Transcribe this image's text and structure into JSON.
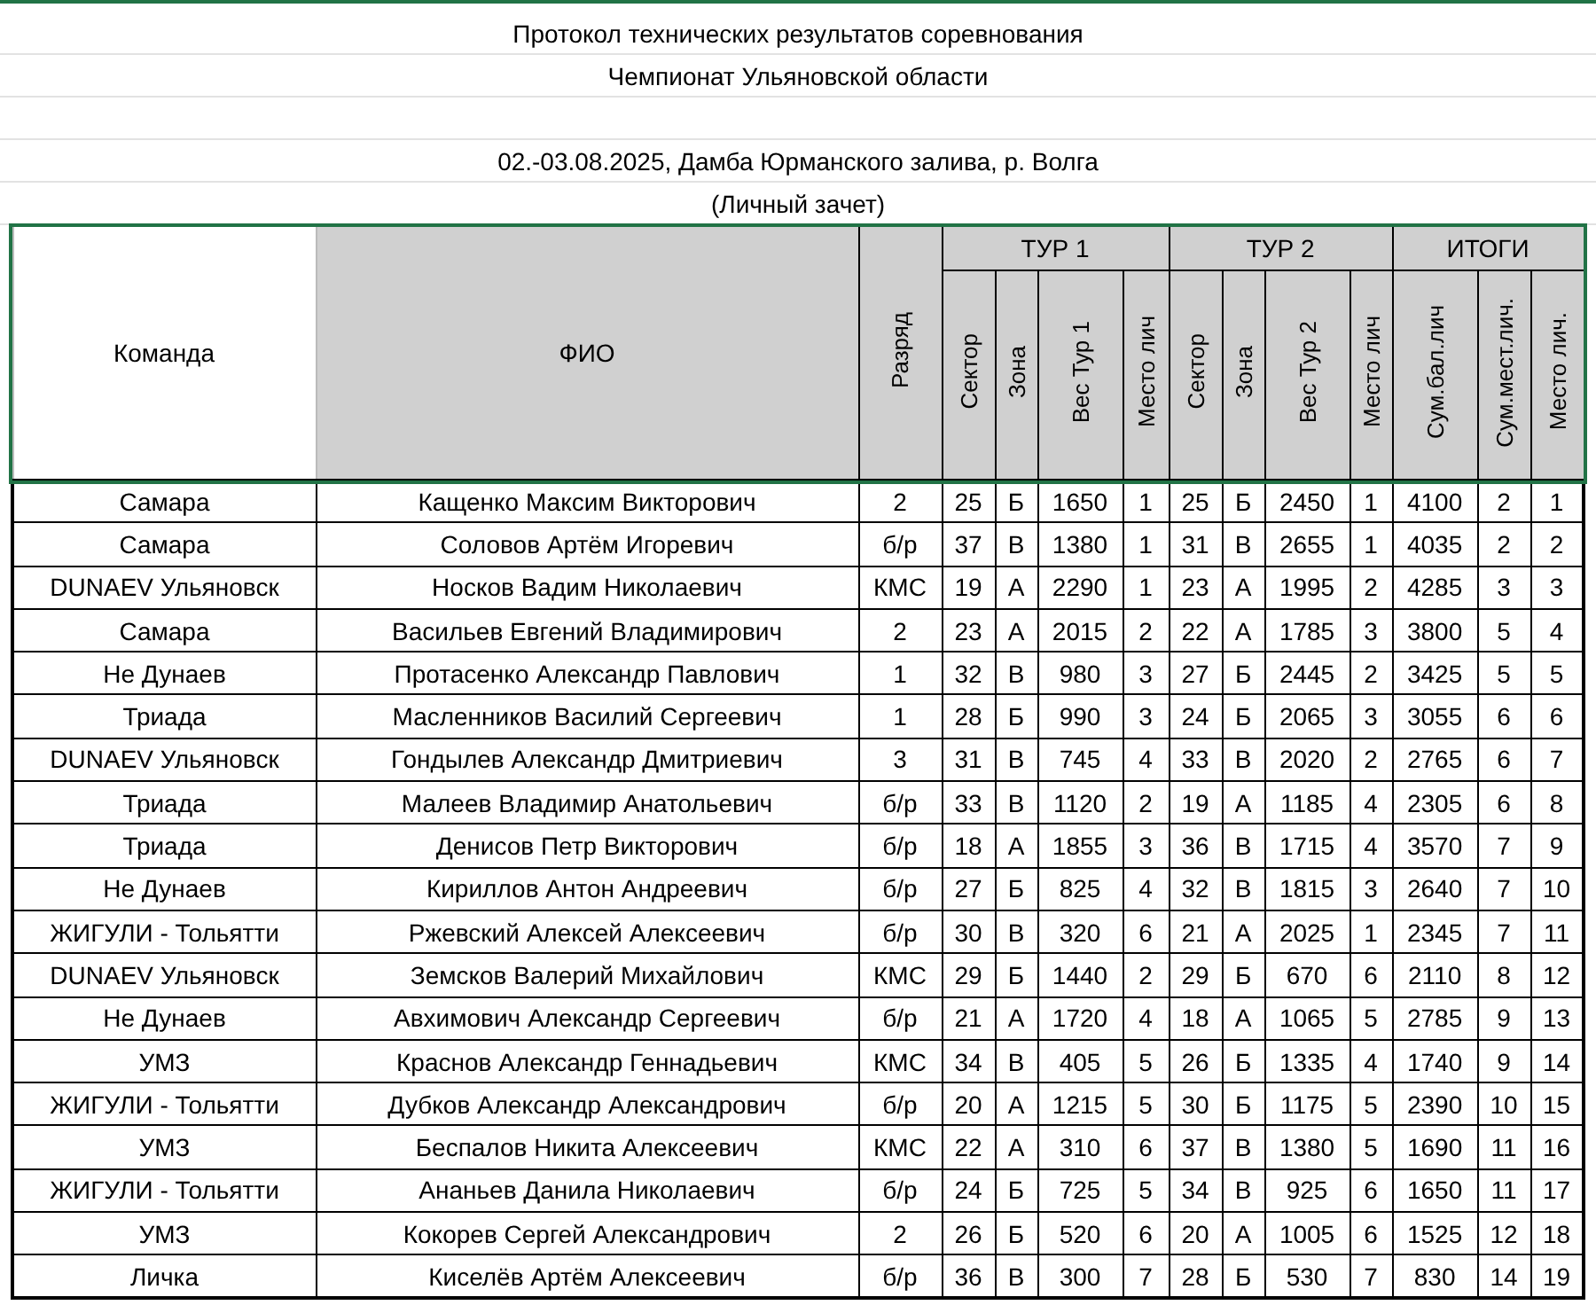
{
  "heading": [
    "Протокол технических результатов соревнования",
    "Чемпионат Ульяновской области"
  ],
  "details": [
    "02.-03.08.2025, Дамба Юрманского залива, р. Волга",
    "(Личный зачет)"
  ],
  "table": {
    "columns": [
      {
        "label": "Команда",
        "vertical": false,
        "shaded": false
      },
      {
        "label": "ФИО",
        "vertical": false,
        "shaded": true
      },
      {
        "label": "Разряд",
        "vertical": true,
        "shaded": true
      }
    ],
    "groups": [
      {
        "label": "ТУР 1",
        "columns": [
          "Сектор",
          "Зона",
          "Вес Тур 1",
          "Место лич"
        ]
      },
      {
        "label": "ТУР 2",
        "columns": [
          "Сектор",
          "Зона",
          "Вес Тур 2",
          "Место лич"
        ]
      },
      {
        "label": "ИТОГИ",
        "columns": [
          "Сум.бал.лич",
          "Сум.мест.лич.",
          "Место лич."
        ]
      }
    ],
    "rows": [
      [
        "Самара",
        "Кащенко Максим Викторович",
        "2",
        "25",
        "Б",
        "1650",
        "1",
        "25",
        "Б",
        "2450",
        "1",
        "4100",
        "2",
        "1"
      ],
      [
        "Самара",
        "Соловов Артём Игоревич",
        "б/р",
        "37",
        "В",
        "1380",
        "1",
        "31",
        "В",
        "2655",
        "1",
        "4035",
        "2",
        "2"
      ],
      [
        "DUNAEV Ульяновск",
        "Носков Вадим Николаевич",
        "КМС",
        "19",
        "А",
        "2290",
        "1",
        "23",
        "А",
        "1995",
        "2",
        "4285",
        "3",
        "3"
      ],
      [
        "Самара",
        "Васильев Евгений Владимирович",
        "2",
        "23",
        "А",
        "2015",
        "2",
        "22",
        "А",
        "1785",
        "3",
        "3800",
        "5",
        "4"
      ],
      [
        "Не Дунаев",
        "Протасенко Александр Павлович",
        "1",
        "32",
        "В",
        "980",
        "3",
        "27",
        "Б",
        "2445",
        "2",
        "3425",
        "5",
        "5"
      ],
      [
        "Триада",
        "Масленников Василий Сергеевич",
        "1",
        "28",
        "Б",
        "990",
        "3",
        "24",
        "Б",
        "2065",
        "3",
        "3055",
        "6",
        "6"
      ],
      [
        "DUNAEV Ульяновск",
        "Гондылев Александр Дмитриевич",
        "3",
        "31",
        "В",
        "745",
        "4",
        "33",
        "В",
        "2020",
        "2",
        "2765",
        "6",
        "7"
      ],
      [
        "Триада",
        "Малеев Владимир Анатольевич",
        "б/р",
        "33",
        "В",
        "1120",
        "2",
        "19",
        "А",
        "1185",
        "4",
        "2305",
        "6",
        "8"
      ],
      [
        "Триада",
        "Денисов Петр Викторович",
        "б/р",
        "18",
        "А",
        "1855",
        "3",
        "36",
        "В",
        "1715",
        "4",
        "3570",
        "7",
        "9"
      ],
      [
        "Не Дунаев",
        "Кириллов Антон Андреевич",
        "б/р",
        "27",
        "Б",
        "825",
        "4",
        "32",
        "В",
        "1815",
        "3",
        "2640",
        "7",
        "10"
      ],
      [
        "ЖИГУЛИ - Тольятти",
        "Ржевский Алексей Алексеевич",
        "б/р",
        "30",
        "В",
        "320",
        "6",
        "21",
        "А",
        "2025",
        "1",
        "2345",
        "7",
        "11"
      ],
      [
        "DUNAEV Ульяновск",
        "Земсков Валерий Михайлович",
        "КМС",
        "29",
        "Б",
        "1440",
        "2",
        "29",
        "Б",
        "670",
        "6",
        "2110",
        "8",
        "12"
      ],
      [
        "Не Дунаев",
        "Авхимович Александр Сергеевич",
        "б/р",
        "21",
        "А",
        "1720",
        "4",
        "18",
        "А",
        "1065",
        "5",
        "2785",
        "9",
        "13"
      ],
      [
        "УМЗ",
        "Краснов Александр Геннадьевич",
        "КМС",
        "34",
        "В",
        "405",
        "5",
        "26",
        "Б",
        "1335",
        "4",
        "1740",
        "9",
        "14"
      ],
      [
        "ЖИГУЛИ - Тольятти",
        "Дубков Александр Александрович",
        "б/р",
        "20",
        "А",
        "1215",
        "5",
        "30",
        "Б",
        "1175",
        "5",
        "2390",
        "10",
        "15"
      ],
      [
        "УМЗ",
        "Беспалов Никита Алексеевич",
        "КМС",
        "22",
        "А",
        "310",
        "6",
        "37",
        "В",
        "1380",
        "5",
        "1690",
        "11",
        "16"
      ],
      [
        "ЖИГУЛИ - Тольятти",
        "Ананьев Данила Николаевич",
        "б/р",
        "24",
        "Б",
        "725",
        "5",
        "34",
        "В",
        "925",
        "6",
        "1650",
        "11",
        "17"
      ],
      [
        "УМЗ",
        "Кокорев Сергей Александрович",
        "2",
        "26",
        "Б",
        "520",
        "6",
        "20",
        "А",
        "1005",
        "6",
        "1525",
        "12",
        "18"
      ],
      [
        "Личка",
        "Киселёв Артём Алексеевич",
        "б/р",
        "36",
        "В",
        "300",
        "7",
        "28",
        "Б",
        "530",
        "7",
        "830",
        "14",
        "19"
      ]
    ]
  }
}
